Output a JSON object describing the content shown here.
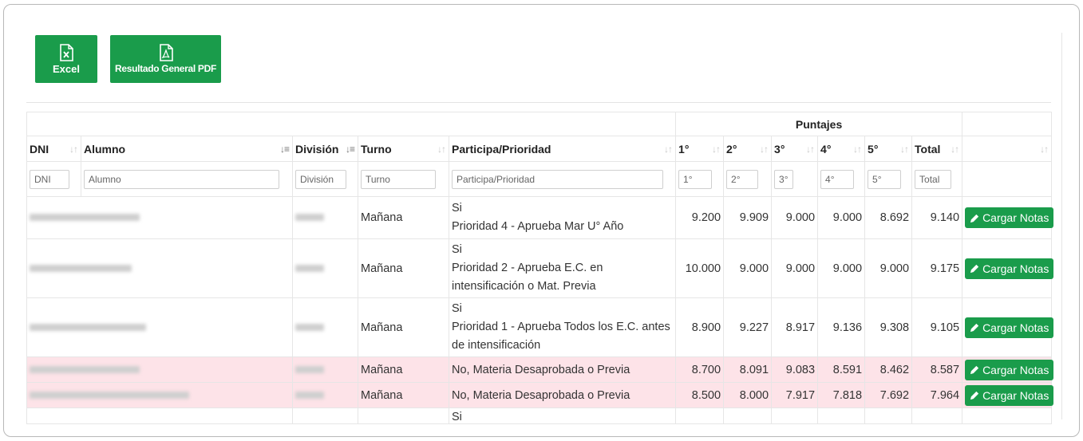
{
  "toolbar": {
    "excel_label": "Excel",
    "pdf_label": "Resultado General PDF",
    "accent_color": "#1a9c4b"
  },
  "table": {
    "group_header": "Puntajes",
    "columns": [
      "DNI",
      "Alumno",
      "División",
      "Turno",
      "Participa/Prioridad",
      "1°",
      "2°",
      "3°",
      "4°",
      "5°",
      "Total"
    ],
    "filters": [
      "DNI",
      "Alumno",
      "División",
      "Turno",
      "Participa/Prioridad",
      "1°",
      "2°",
      "3°",
      "4°",
      "5°",
      "Total"
    ],
    "action_label": "Cargar Notas",
    "rows": [
      {
        "turno": "Mañana",
        "participa": "Si",
        "prioridad": "Prioridad 4 - Aprueba Mar U° Año",
        "s1": "9.200",
        "s2": "9.909",
        "s3": "9.000",
        "s4": "9.000",
        "s5": "8.692",
        "total": "9.140"
      },
      {
        "turno": "Mañana",
        "participa": "Si",
        "prioridad": "Prioridad 2 - Aprueba E.C. en intensificación o Mat. Previa",
        "s1": "10.000",
        "s2": "9.000",
        "s3": "9.000",
        "s4": "9.000",
        "s5": "9.000",
        "total": "9.175"
      },
      {
        "turno": "Mañana",
        "participa": "Si",
        "prioridad": "Prioridad 1 - Aprueba Todos los E.C. antes de intensificación",
        "s1": "8.900",
        "s2": "9.227",
        "s3": "8.917",
        "s4": "9.136",
        "s5": "9.308",
        "total": "9.105"
      },
      {
        "turno": "Mañana",
        "participa": "No, Materia Desaprobada o Previa",
        "prioridad": "",
        "s1": "8.700",
        "s2": "8.091",
        "s3": "9.083",
        "s4": "8.591",
        "s5": "8.462",
        "total": "8.587"
      },
      {
        "turno": "Mañana",
        "participa": "No, Materia Desaprobada o Previa",
        "prioridad": "",
        "s1": "8.500",
        "s2": "8.000",
        "s3": "7.917",
        "s4": "7.818",
        "s5": "7.692",
        "total": "7.964"
      },
      {
        "participa": "Si"
      }
    ]
  }
}
